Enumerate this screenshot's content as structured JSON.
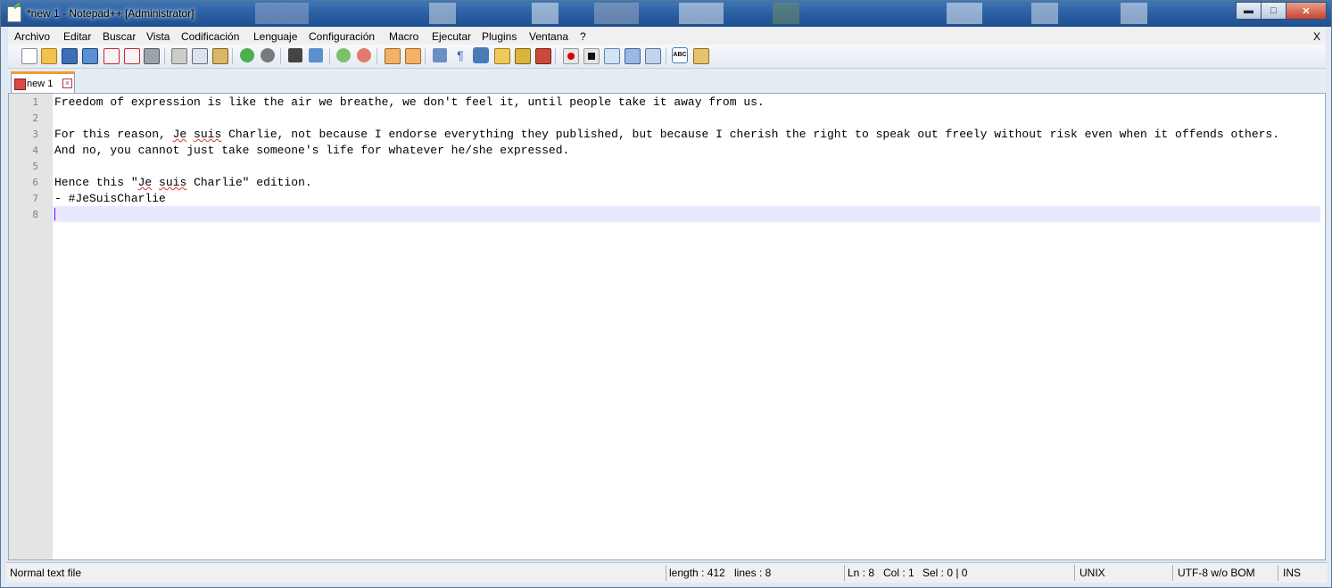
{
  "window": {
    "title": "*new  1 - Notepad++ [Administrator]"
  },
  "menu": {
    "items": [
      "Archivo",
      "Editar",
      "Buscar",
      "Vista",
      "Codificación",
      "Lenguaje",
      "Configuración",
      "Macro",
      "Ejecutar",
      "Plugins",
      "Ventana",
      "?"
    ],
    "close": "X"
  },
  "toolbar": {
    "icons": [
      "new-file",
      "open-file",
      "save",
      "save-all",
      "close",
      "close-all",
      "print",
      "cut",
      "copy",
      "paste",
      "undo",
      "redo",
      "find",
      "replace",
      "zoom-in",
      "zoom-out",
      "sync-vertical",
      "sync-horizontal",
      "word-wrap",
      "show-all-chars",
      "indent-guide",
      "user-language",
      "document-map",
      "function-list",
      "record-macro",
      "stop-macro",
      "play-macro",
      "run-macro-multiple",
      "save-macro",
      "spell-check",
      "abc-options"
    ]
  },
  "tabs": [
    {
      "label": "new  1"
    }
  ],
  "editor": {
    "line_numbers": [
      "1",
      "2",
      "3",
      "4",
      "5",
      "6",
      "7",
      "8"
    ],
    "lines": [
      "Freedom of expression is like the air we breathe, we don't feel it, until people take it away from us.",
      "",
      "For this reason, Je suis Charlie, not because I endorse everything they published, but because I cherish the right to speak out freely without risk even when it offends others.",
      "And no, you cannot just take someone's life for whatever he/she expressed.",
      "",
      "Hence this \"Je suis Charlie\" edition.",
      "- #JeSuisCharlie",
      ""
    ]
  },
  "status": {
    "file_type": "Normal text file",
    "length": "length : 412",
    "lines": "lines : 8",
    "ln": "Ln : 8",
    "col": "Col : 1",
    "sel": "Sel : 0 | 0",
    "eol": "UNIX",
    "encoding": "UTF-8 w/o BOM",
    "mode": "INS"
  }
}
